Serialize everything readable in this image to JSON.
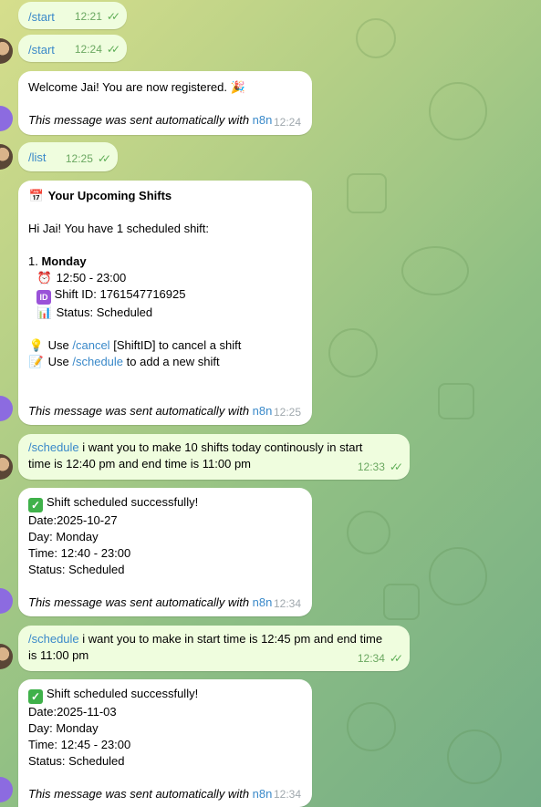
{
  "messages": {
    "m1": {
      "text": "/start",
      "time": "12:21"
    },
    "m2": {
      "text": "/start",
      "time": "12:24"
    },
    "m3": {
      "text": "Welcome Jai! You are now registered.",
      "emoji": "🎉",
      "auto_prefix": "This message was sent automatically with",
      "auto_link": "n8n",
      "time": "12:24"
    },
    "m4": {
      "text": "/list",
      "time": "12:25"
    },
    "m5": {
      "title_icon": "📅",
      "title": "Your Upcoming Shifts",
      "greeting": "Hi Jai! You have 1 scheduled shift:",
      "item_index": "1.",
      "item_day": "Monday",
      "time_icon": "⏰",
      "time_text": "12:50 - 23:00",
      "id_icon": "ID",
      "id_text": "Shift ID: 1761547716925",
      "status_icon": "📊",
      "status_text": "Status: Scheduled",
      "tip1_icon": "💡",
      "tip1_pre": "Use",
      "tip1_cmd": "/cancel",
      "tip1_post": "[ShiftID] to cancel a shift",
      "tip2_icon": "📝",
      "tip2_pre": "Use",
      "tip2_cmd": "/schedule",
      "tip2_post": "to add a new shift",
      "auto_prefix": "This message was sent automatically with",
      "auto_link": "n8n",
      "time": "12:25"
    },
    "m6": {
      "cmd": "/schedule",
      "text": "i want you to make 10 shifts today continously in start",
      "text2": "time is 12:40 pm and end time is 11:00 pm",
      "time": "12:33"
    },
    "m7": {
      "check": "✓",
      "title": "Shift scheduled successfully!",
      "date": "Date:2025-10-27",
      "day": "Day: Monday",
      "time_range": "Time: 12:40 - 23:00",
      "status": "Status: Scheduled",
      "auto_prefix": "This message was sent automatically with",
      "auto_link": "n8n",
      "time": "12:34"
    },
    "m8": {
      "cmd": "/schedule",
      "text": "i want you to make in start time is 12:45 pm and end time",
      "text2": "is 11:00 pm",
      "time": "12:34"
    },
    "m9": {
      "check": "✓",
      "title": "Shift scheduled successfully!",
      "date": "Date:2025-11-03",
      "day": "Day: Monday",
      "time_range": "Time: 12:45 - 23:00",
      "status": "Status: Scheduled",
      "auto_prefix": "This message was sent automatically with",
      "auto_link": "n8n",
      "time": "12:34"
    }
  },
  "ticks": "✓✓"
}
